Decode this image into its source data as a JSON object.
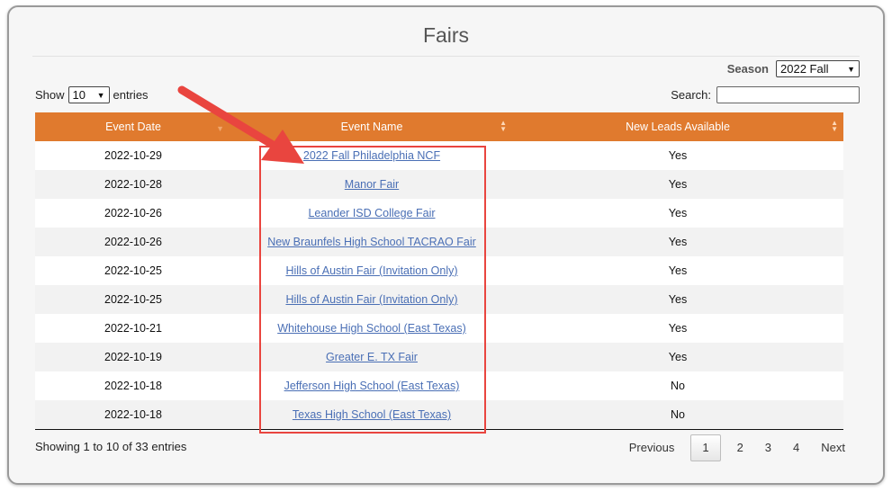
{
  "title": "Fairs",
  "season": {
    "label": "Season",
    "selected": "2022 Fall"
  },
  "length_menu": {
    "prefix": "Show",
    "selected": "10",
    "suffix": "entries"
  },
  "search": {
    "label": "Search:",
    "value": ""
  },
  "table": {
    "columns": [
      "Event Date",
      "Event Name",
      "New Leads Available"
    ],
    "rows": [
      {
        "date": "2022-10-29",
        "name": "2022 Fall Philadelphia NCF",
        "leads": "Yes"
      },
      {
        "date": "2022-10-28",
        "name": "Manor Fair",
        "leads": "Yes"
      },
      {
        "date": "2022-10-26",
        "name": "Leander ISD College Fair",
        "leads": "Yes"
      },
      {
        "date": "2022-10-26",
        "name": "New Braunfels High School TACRAO Fair",
        "leads": "Yes"
      },
      {
        "date": "2022-10-25",
        "name": "Hills of Austin Fair (Invitation Only)",
        "leads": "Yes"
      },
      {
        "date": "2022-10-25",
        "name": "Hills of Austin Fair (Invitation Only)",
        "leads": "Yes"
      },
      {
        "date": "2022-10-21",
        "name": "Whitehouse High School (East Texas)",
        "leads": "Yes"
      },
      {
        "date": "2022-10-19",
        "name": "Greater E. TX Fair",
        "leads": "Yes"
      },
      {
        "date": "2022-10-18",
        "name": "Jefferson High School (East Texas)",
        "leads": "No"
      },
      {
        "date": "2022-10-18",
        "name": "Texas High School (East Texas)",
        "leads": "No"
      }
    ]
  },
  "info": "Showing 1 to 10 of 33 entries",
  "pagination": {
    "previous": "Previous",
    "pages": [
      "1",
      "2",
      "3",
      "4"
    ],
    "current": "1",
    "next": "Next"
  },
  "annotation": {
    "arrow_color": "#e9453f",
    "box_color": "#e9453f"
  },
  "colors": {
    "header": "#e07a2e",
    "link": "#4a6fb5"
  },
  "icons": [
    "sort-desc-icon",
    "sort-both-icon",
    "dropdown-caret-icon",
    "annotation-arrow-icon"
  ]
}
